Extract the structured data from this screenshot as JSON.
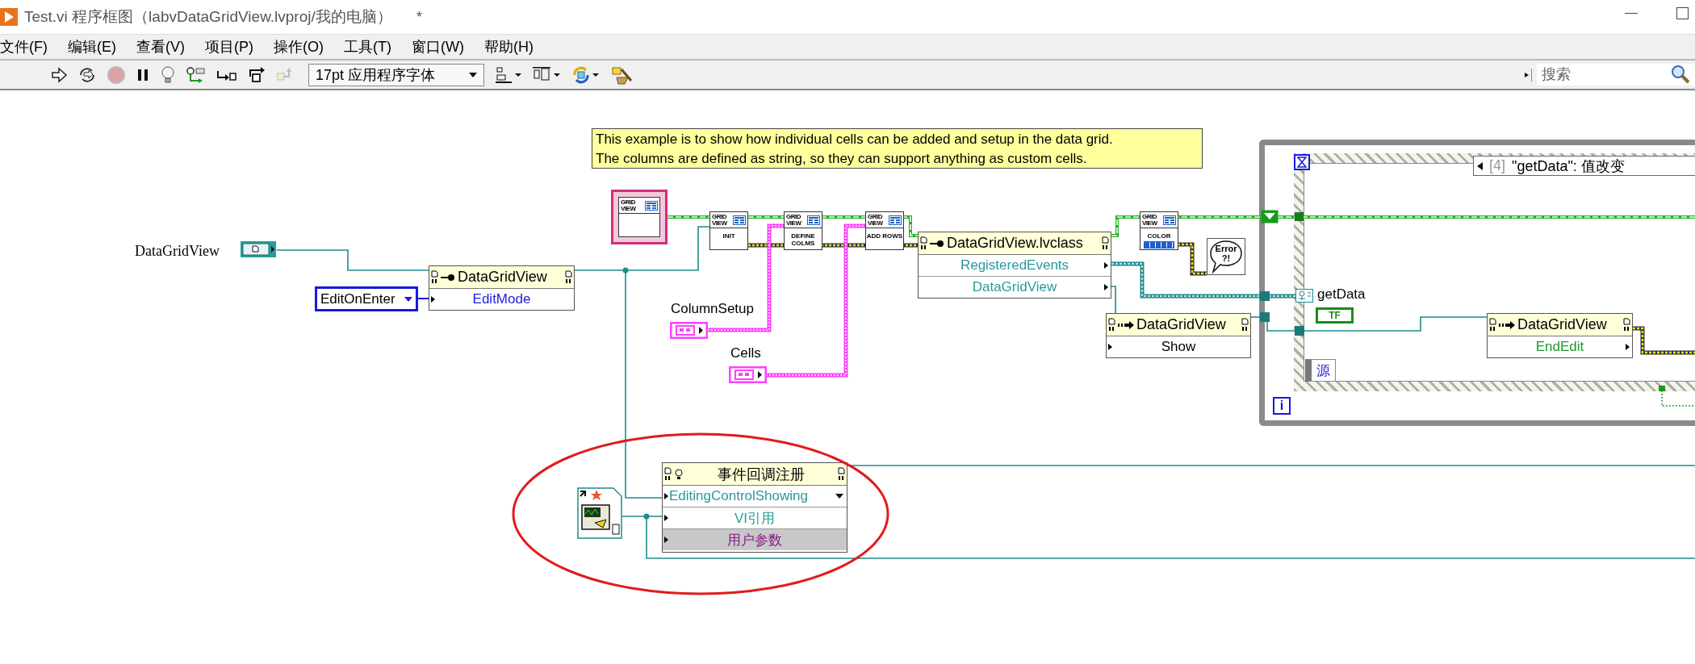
{
  "window": {
    "title": "Test.vi 程序框图（labvDataGridView.lvproj/我的电脑）",
    "modified_mark": "*"
  },
  "menu": [
    "文件(F)",
    "编辑(E)",
    "查看(V)",
    "项目(P)",
    "操作(O)",
    "工具(T)",
    "窗口(W)",
    "帮助(H)"
  ],
  "toolbar": {
    "font": "17pt 应用程序字体",
    "search": {
      "placeholder": "搜索"
    }
  },
  "diagram": {
    "comment": [
      "This example is to show how individual cells can be added and setup in the data grid.",
      "The columns are defined as string, so they can support anything as custom cells."
    ],
    "control": {
      "label": "DataGridView"
    },
    "enum_constant": {
      "value": "EditOnEnter"
    },
    "property_node": {
      "title": "DataGridView",
      "rows": [
        "EditMode"
      ]
    },
    "class_constant": {
      "banner": "GRID VIEW"
    },
    "subvis": [
      {
        "banner": "GRID VIEW",
        "label": "INIT",
        "kind": "plain"
      },
      {
        "banner": "GRID VIEW",
        "label": "DEFINE COLMS",
        "kind": "plain"
      },
      {
        "banner": "GRID VIEW",
        "label": "ADD ROWS",
        "kind": "plain"
      },
      {
        "banner": "GRID VIEW",
        "label": "COLOR",
        "kind": "palette"
      }
    ],
    "array_constants": [
      {
        "label": "ColumnSetup"
      },
      {
        "label": "Cells"
      }
    ],
    "class_node": {
      "title": "DataGridView.lvclass",
      "rows": [
        "RegisteredEvents",
        "DataGridView"
      ]
    },
    "error_handler": {
      "lines": [
        "Error",
        "?!"
      ]
    },
    "invoke_nodes": [
      {
        "title": "DataGridView",
        "method": "Show"
      },
      {
        "title": "DataGridView",
        "method": "EndEdit"
      }
    ],
    "event_structure": {
      "case_index": "[4]",
      "case_name": "\"getData\": 值改变",
      "event_data": "getData",
      "boolean_constant": "TF",
      "source_label": "源"
    },
    "while_loop": {
      "iteration_label": "i"
    },
    "callback_node": {
      "title": "事件回调注册",
      "rows": [
        {
          "label": "EditingControlShowing",
          "kind": "event"
        },
        {
          "label": "VI引用",
          "kind": "reference"
        },
        {
          "label": "用户参数",
          "kind": "parameter"
        }
      ]
    }
  }
}
